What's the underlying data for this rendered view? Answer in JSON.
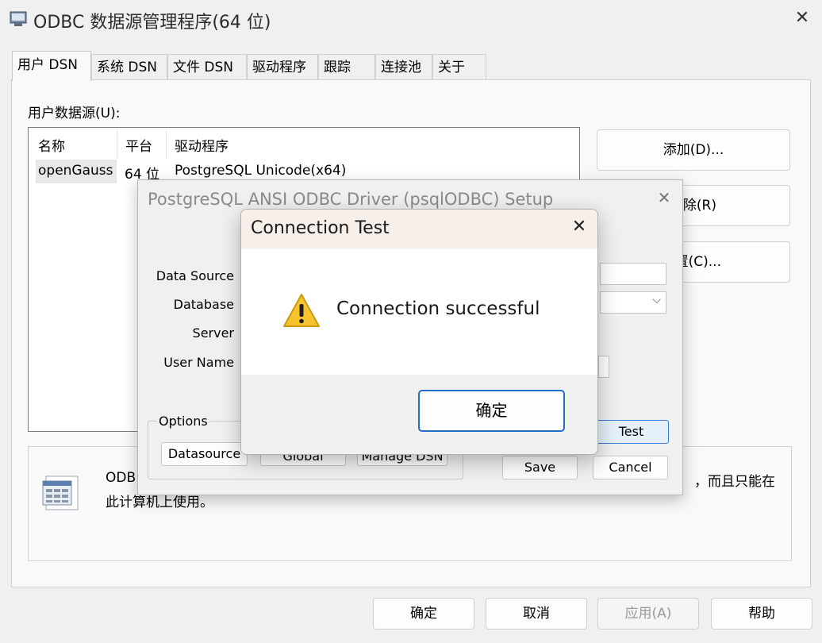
{
  "window": {
    "title": "ODBC 数据源管理程序(64 位)",
    "close_glyph": "✕"
  },
  "tabs": [
    {
      "label": "用户 DSN",
      "active": true
    },
    {
      "label": "系统 DSN"
    },
    {
      "label": "文件 DSN"
    },
    {
      "label": "驱动程序"
    },
    {
      "label": "跟踪"
    },
    {
      "label": "连接池"
    },
    {
      "label": "关于"
    }
  ],
  "user_dsn": {
    "label": "用户数据源(U):",
    "columns": [
      "名称",
      "平台",
      "驱动程序"
    ],
    "rows": [
      {
        "name": "openGauss",
        "platform": "64 位",
        "driver": "PostgreSQL Unicode(x64)"
      }
    ],
    "buttons": {
      "add": "添加(D)...",
      "remove": "除(R)",
      "configure": "置(C)..."
    },
    "info_text_line1": "ODB",
    "info_text_line2": "此计算机上使用。",
    "info_text_right": "，而且只能在"
  },
  "bottom_buttons": {
    "ok": "确定",
    "cancel": "取消",
    "apply": "应用(A)",
    "help": "帮助"
  },
  "setup_dialog": {
    "title": "PostgreSQL ANSI ODBC Driver (psqlODBC) Setup",
    "close_glyph": "✕",
    "labels": {
      "data_source": "Data Source",
      "database": "Database",
      "server": "Server",
      "user_name": "User Name"
    },
    "options_label": "Options",
    "buttons": {
      "datasource": "Datasource",
      "global": "Global",
      "manage_dsn": "Manage DSN",
      "test": "Test",
      "save": "Save",
      "cancel": "Cancel"
    }
  },
  "connection_test": {
    "title": "Connection Test",
    "close_glyph": "✕",
    "message": "Connection successful",
    "ok_label": "确定"
  }
}
